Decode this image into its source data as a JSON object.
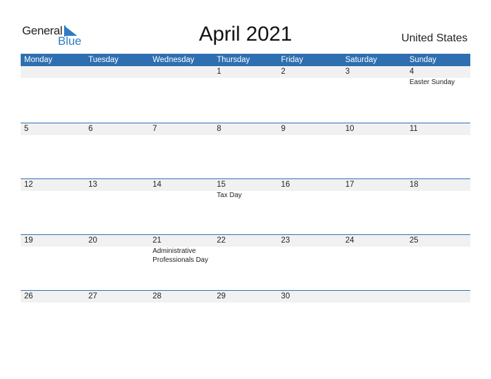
{
  "logo": {
    "general": "General",
    "blue": "Blue"
  },
  "title": "April 2021",
  "country": "United States",
  "weekdays": [
    "Monday",
    "Tuesday",
    "Wednesday",
    "Thursday",
    "Friday",
    "Saturday",
    "Sunday"
  ],
  "weeks": [
    [
      {
        "d": ""
      },
      {
        "d": ""
      },
      {
        "d": ""
      },
      {
        "d": "1"
      },
      {
        "d": "2"
      },
      {
        "d": "3"
      },
      {
        "d": "4",
        "event": "Easter Sunday"
      }
    ],
    [
      {
        "d": "5"
      },
      {
        "d": "6"
      },
      {
        "d": "7"
      },
      {
        "d": "8"
      },
      {
        "d": "9"
      },
      {
        "d": "10"
      },
      {
        "d": "11"
      }
    ],
    [
      {
        "d": "12"
      },
      {
        "d": "13"
      },
      {
        "d": "14"
      },
      {
        "d": "15",
        "event": "Tax Day"
      },
      {
        "d": "16"
      },
      {
        "d": "17"
      },
      {
        "d": "18"
      }
    ],
    [
      {
        "d": "19"
      },
      {
        "d": "20"
      },
      {
        "d": "21",
        "event": "Administrative Professionals Day"
      },
      {
        "d": "22"
      },
      {
        "d": "23"
      },
      {
        "d": "24"
      },
      {
        "d": "25"
      }
    ],
    [
      {
        "d": "26"
      },
      {
        "d": "27"
      },
      {
        "d": "28"
      },
      {
        "d": "29"
      },
      {
        "d": "30"
      },
      {
        "d": ""
      },
      {
        "d": ""
      }
    ]
  ],
  "colors": {
    "accent": "#2e6fb2",
    "strip": "#f1f1f1"
  }
}
